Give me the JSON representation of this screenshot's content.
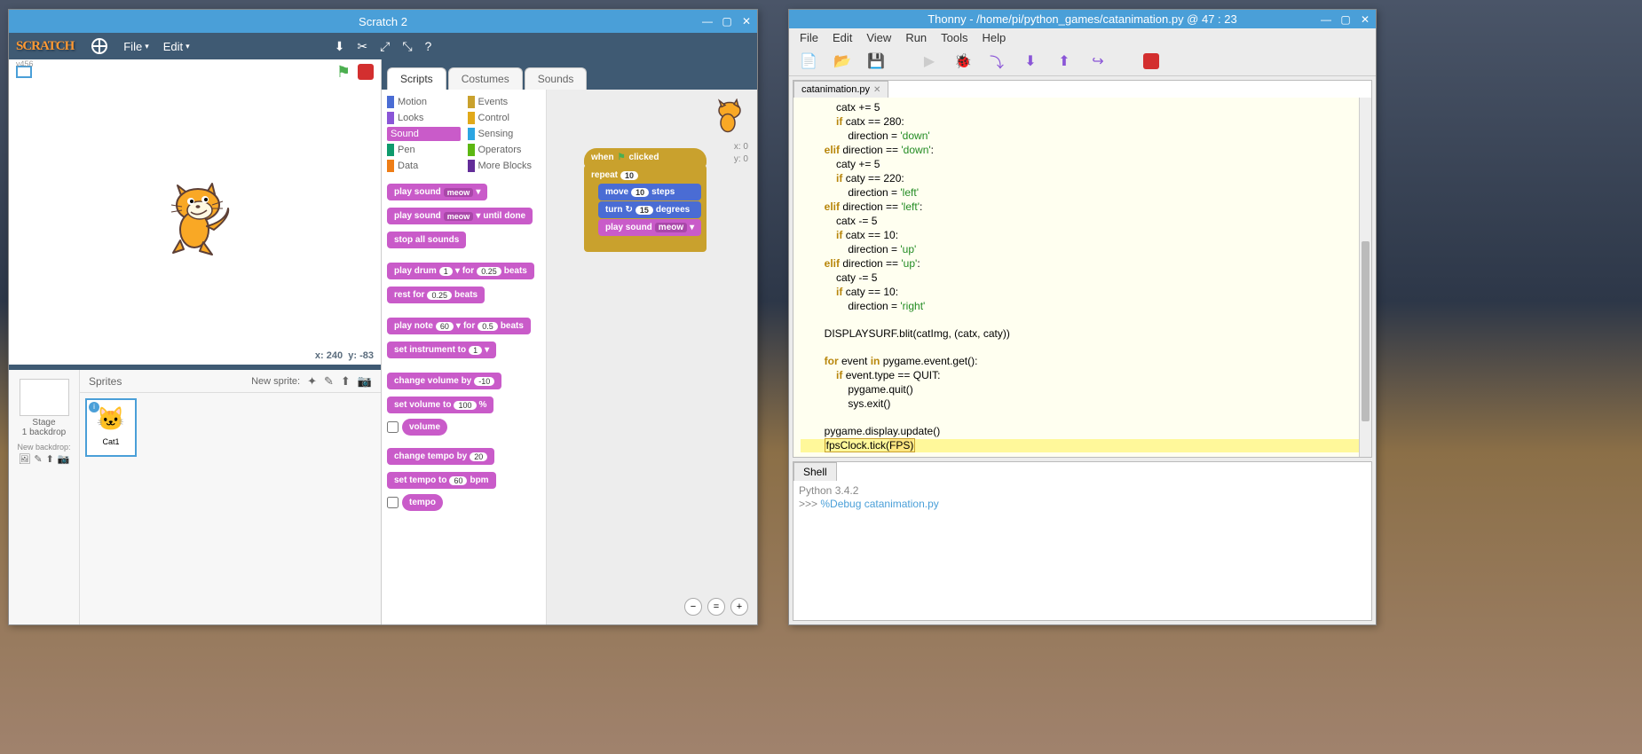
{
  "scratch": {
    "title": "Scratch 2",
    "logo": "SCRATCH",
    "menu": {
      "file": "File",
      "edit": "Edit"
    },
    "stage_label": "v456",
    "coords": {
      "x_label": "x:",
      "x": "240",
      "y_label": "y:",
      "y": "-83"
    },
    "stage_col": {
      "stage": "Stage",
      "backdrop": "1 backdrop",
      "new_backdrop": "New backdrop:"
    },
    "sprites": {
      "header": "Sprites",
      "new_sprite": "New sprite:",
      "cat1": "Cat1"
    },
    "tabs": {
      "scripts": "Scripts",
      "costumes": "Costumes",
      "sounds": "Sounds"
    },
    "categories": {
      "motion": "Motion",
      "events": "Events",
      "looks": "Looks",
      "control": "Control",
      "sound": "Sound",
      "sensing": "Sensing",
      "pen": "Pen",
      "operators": "Operators",
      "data": "Data",
      "more": "More Blocks"
    },
    "blocks": {
      "play_sound": "play sound",
      "meow": "meow",
      "play_sound_until": "play sound",
      "until_done": "until done",
      "stop_all": "stop all sounds",
      "play_drum": "play drum",
      "drum_n": "1",
      "for": "for",
      "beats025": "0.25",
      "beats": "beats",
      "rest_for": "rest for",
      "play_note": "play note",
      "note60": "60",
      "beats05": "0.5",
      "set_instrument": "set instrument to",
      "instr1": "1",
      "change_volume": "change volume by",
      "volm10": "-10",
      "set_volume": "set volume to",
      "vol100": "100",
      "pct": "%",
      "volume": "volume",
      "change_tempo": "change tempo by",
      "tempo20": "20",
      "set_tempo": "set tempo to",
      "tempo60": "60",
      "bpm": "bpm",
      "tempo": "tempo"
    },
    "script": {
      "when": "when",
      "clicked": "clicked",
      "repeat": "repeat",
      "repeat_n": "10",
      "move": "move",
      "move_n": "10",
      "steps": "steps",
      "turn": "turn",
      "turn_n": "15",
      "degrees": "degrees",
      "play_sound": "play sound",
      "meow": "meow"
    },
    "xy_readout": {
      "x": "x: 0",
      "y": "y: 0"
    }
  },
  "thonny": {
    "title": "Thonny  -  /home/pi/python_games/catanimation.py  @  47 : 23",
    "menu": {
      "file": "File",
      "edit": "Edit",
      "view": "View",
      "run": "Run",
      "tools": "Tools",
      "help": "Help"
    },
    "tab": "catanimation.py",
    "code": {
      "l1": "            catx += 5",
      "l2a": "            ",
      "l2b": "if",
      "l2c": " catx == 280:",
      "l3a": "                direction = ",
      "l3b": "'down'",
      "l4a": "        ",
      "l4b": "elif",
      "l4c": " direction == ",
      "l4d": "'down'",
      "l4e": ":",
      "l5": "            caty += 5",
      "l6a": "            ",
      "l6b": "if",
      "l6c": " caty == 220:",
      "l7a": "                direction = ",
      "l7b": "'left'",
      "l8a": "        ",
      "l8b": "elif",
      "l8c": " direction == ",
      "l8d": "'left'",
      "l8e": ":",
      "l9": "            catx -= 5",
      "l10a": "            ",
      "l10b": "if",
      "l10c": " catx == 10:",
      "l11a": "                direction = ",
      "l11b": "'up'",
      "l12a": "        ",
      "l12b": "elif",
      "l12c": " direction == ",
      "l12d": "'up'",
      "l12e": ":",
      "l13": "            caty -= 5",
      "l14a": "            ",
      "l14b": "if",
      "l14c": " caty == 10:",
      "l15a": "                direction = ",
      "l15b": "'right'",
      "blank1": "",
      "l16": "        DISPLAYSURF.blit(catImg, (catx, caty))",
      "blank2": "",
      "l17a": "        ",
      "l17b": "for",
      "l17c": " event ",
      "l17d": "in",
      "l17e": " pygame.event.get():",
      "l18a": "            ",
      "l18b": "if",
      "l18c": " event.type == QUIT:",
      "l19": "                pygame.quit()",
      "l20": "                sys.exit()",
      "blank3": "",
      "l21": "        pygame.display.update()",
      "l22a": "        ",
      "l22b": "fpsClock.tick(",
      "l22c": "FPS)"
    },
    "shell": {
      "tab": "Shell",
      "version": "Python 3.4.2",
      "prompt": ">>> ",
      "cmd": "%Debug catanimation.py"
    }
  }
}
